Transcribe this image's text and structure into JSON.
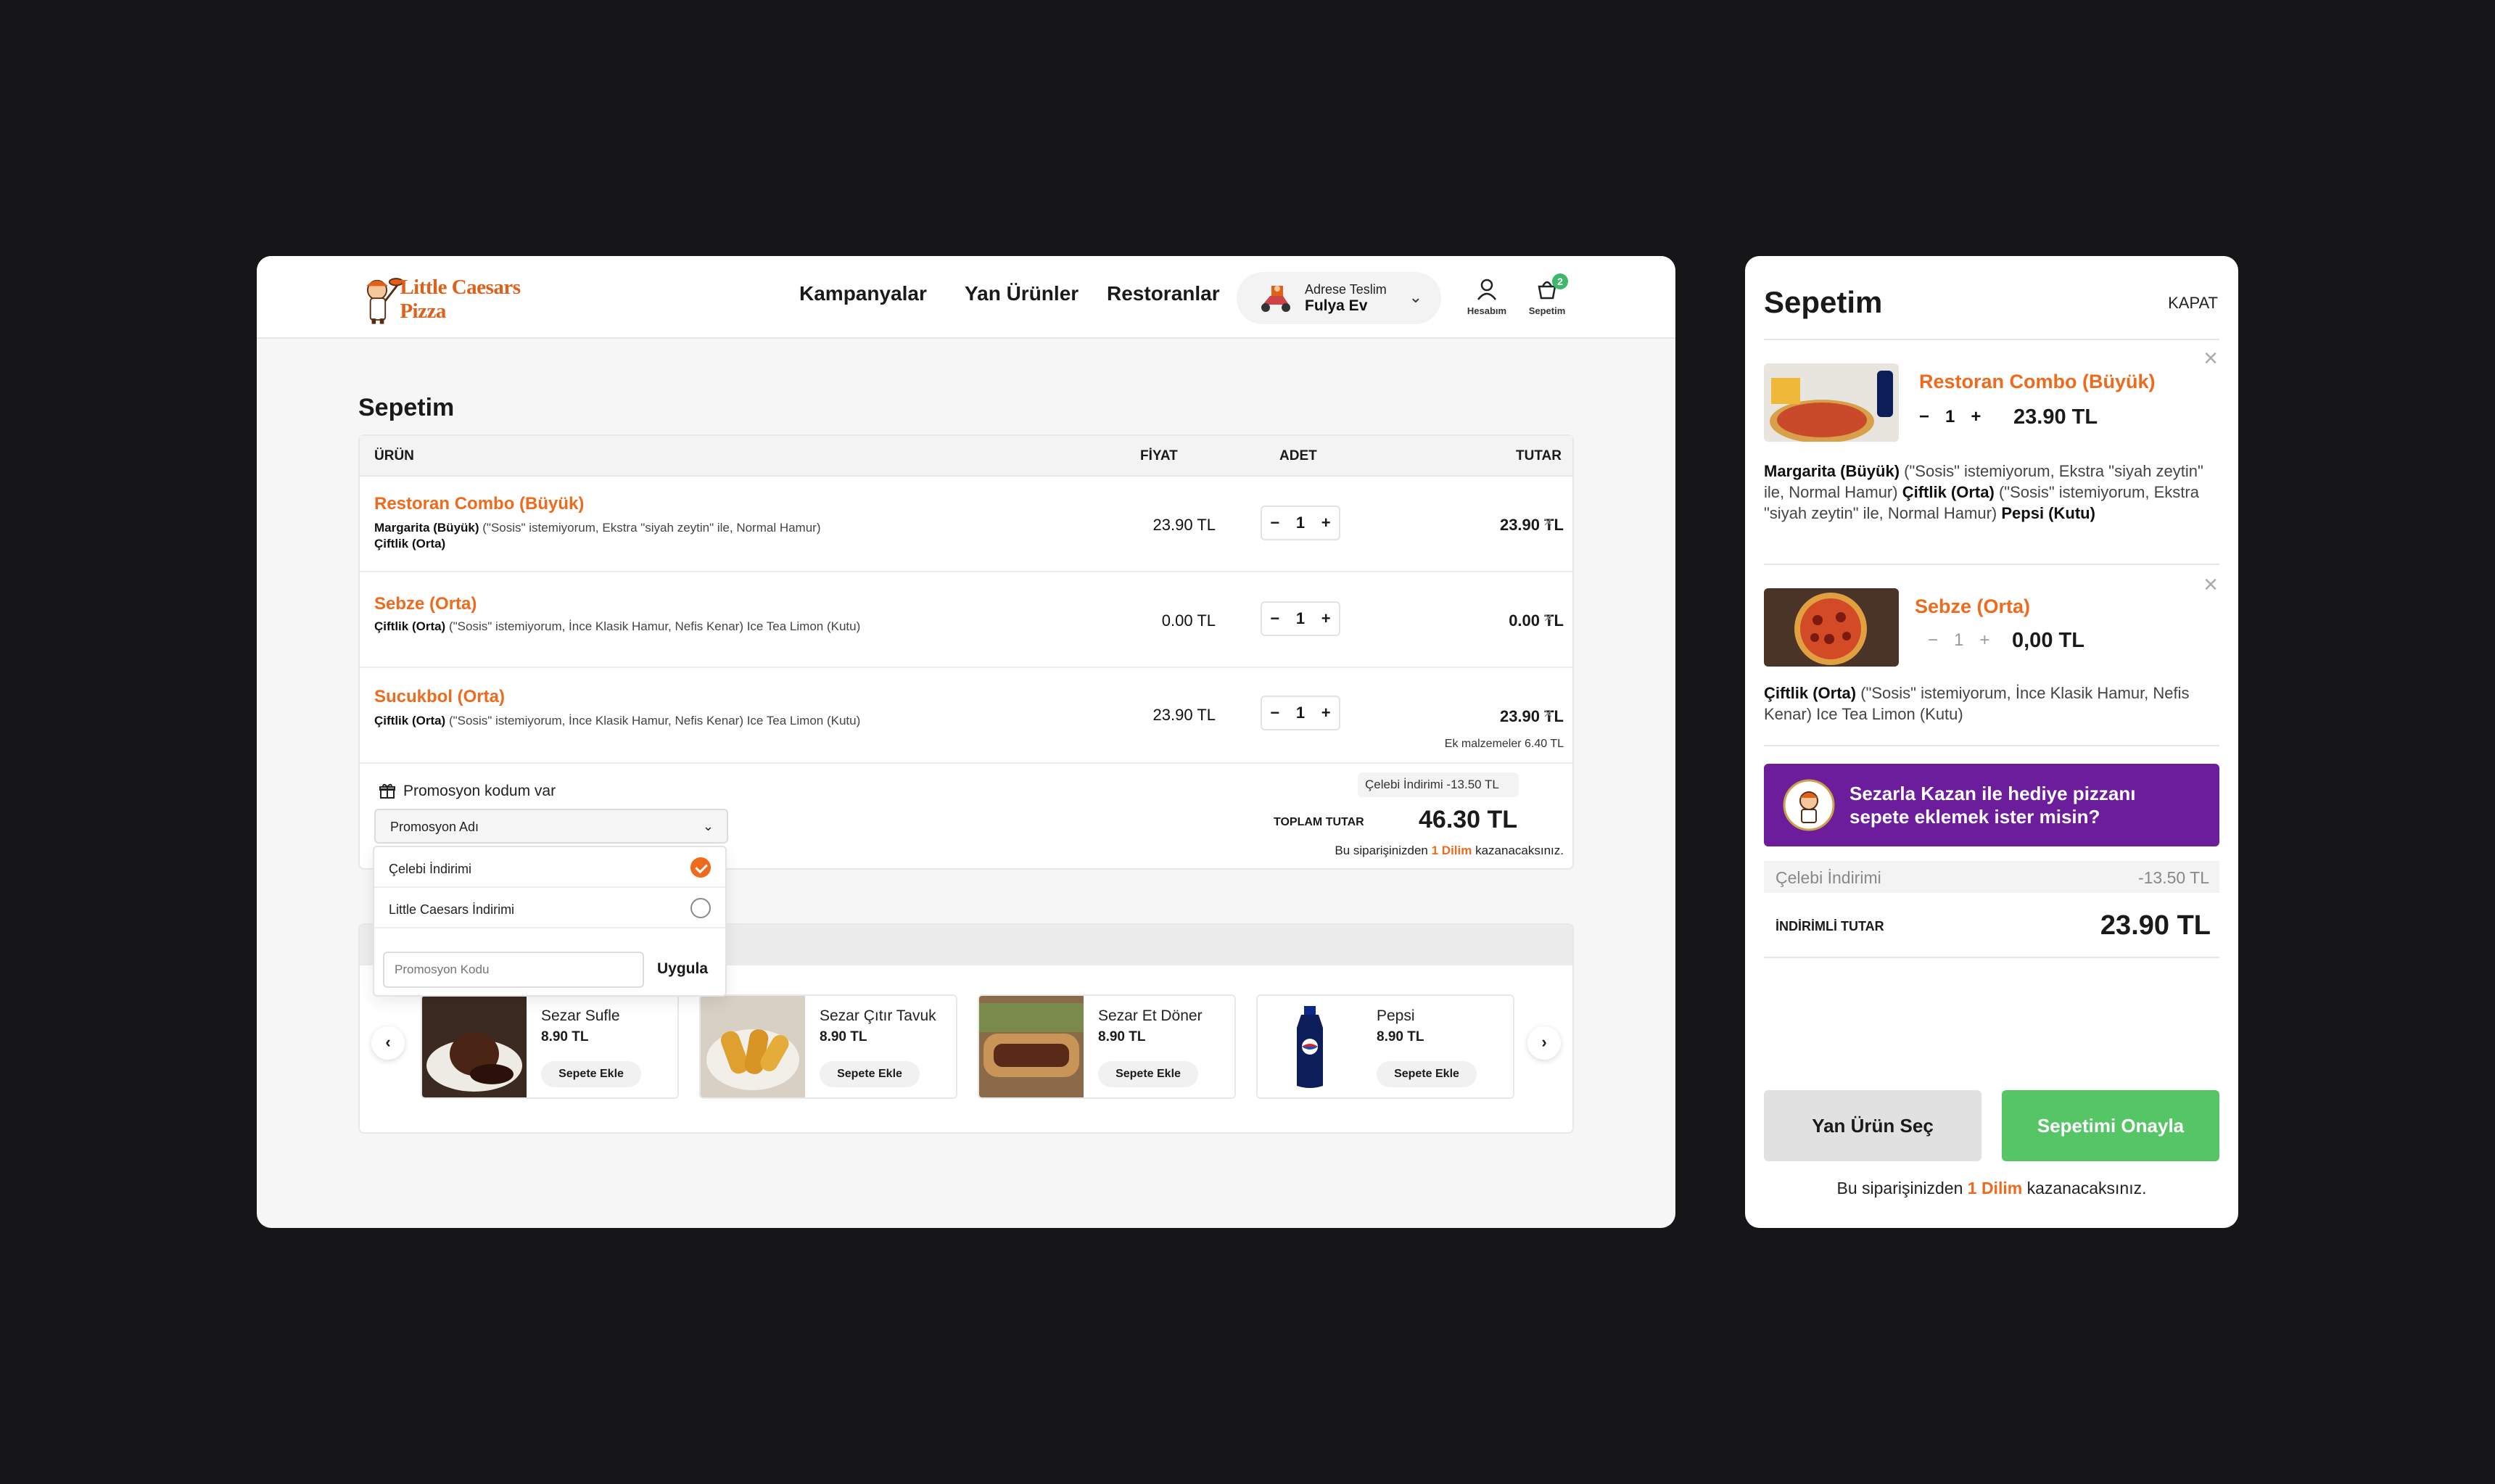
{
  "header": {
    "brand": "Little Caesars Pizza",
    "nav": [
      "Kampanyalar",
      "Yan Ürünler",
      "Restoranlar"
    ],
    "address": {
      "label": "Adrese Teslim",
      "value": "Fulya Ev"
    },
    "account_label": "Hesabım",
    "cart_label": "Sepetim",
    "cart_count": "2"
  },
  "page": {
    "title": "Sepetim",
    "columns": {
      "product": "ÜRÜN",
      "price": "FİYAT",
      "qty": "ADET",
      "total": "TUTAR"
    },
    "items": [
      {
        "name": "Restoran Combo (Büyük)",
        "desc_bold1": "Margarita (Büyük)",
        "desc1": " (\"Sosis\" istemiyorum, Ekstra \"siyah zeytin\" ile, Normal Hamur) ",
        "desc_bold2": "Çiftlik (Orta)",
        "price": "23.90 TL",
        "qty": "1",
        "total": "23.90 TL",
        "extra": ""
      },
      {
        "name": "Sebze (Orta)",
        "desc_bold1": "Çiftlik (Orta)",
        "desc1": " (\"Sosis\" istemiyorum, İnce Klasik Hamur, Nefis Kenar) Ice Tea Limon (Kutu)",
        "desc_bold2": "",
        "price": "0.00 TL",
        "qty": "1",
        "total": "0.00 TL",
        "extra": ""
      },
      {
        "name": "Sucukbol (Orta)",
        "desc_bold1": "Çiftlik (Orta)",
        "desc1": " (\"Sosis\" istemiyorum, İnce Klasik Hamur, Nefis Kenar) Ice Tea Limon (Kutu)",
        "desc_bold2": "",
        "price": "23.90 TL",
        "qty": "1",
        "total": "23.90 TL",
        "extra": "Ek malzemeler 6.40 TL"
      }
    ],
    "promo": {
      "toggle_label": "Promosyon kodum var",
      "select_value": "Promosyon Adı",
      "options": [
        {
          "label": "Çelebi İndirimi",
          "selected": true
        },
        {
          "label": "Little Caesars İndirimi",
          "selected": false
        }
      ],
      "code_placeholder": "Promosyon Kodu",
      "apply_label": "Uygula"
    },
    "summary": {
      "discount": "Çelebi İndirimi  -13.50 TL",
      "total_label": "TOPLAM TUTAR",
      "total_value": "46.30 TL",
      "earn_prefix": "Bu siparişinizden ",
      "earn_highlight": "1 Dilim",
      "earn_suffix": " kazanacaksınız."
    },
    "side_products": [
      {
        "name": "Sezar Sufle",
        "price": "8.90 TL",
        "button": "Sepete Ekle"
      },
      {
        "name": "Sezar Çıtır Tavuk",
        "price": "8.90 TL",
        "button": "Sepete Ekle"
      },
      {
        "name": "Sezar Et Döner",
        "price": "8.90 TL",
        "button": "Sepete Ekle"
      },
      {
        "name": "Pepsi",
        "price": "8.90 TL",
        "button": "Sepete Ekle"
      }
    ]
  },
  "side_cart": {
    "title": "Sepetim",
    "close_label": "KAPAT",
    "items": [
      {
        "name": "Restoran Combo (Büyük)",
        "qty": "1",
        "total": "23.90 TL",
        "bold1": "Margarita (Büyük)",
        "text1": " (\"Sosis\" istemiyorum, Ekstra \"siyah zeytin\" ile, Normal Hamur) ",
        "bold2": "Çiftlik (Orta)",
        "text2": " (\"Sosis\" istemiyorum, Ekstra \"siyah zeytin\" ile, Normal Hamur) ",
        "bold3": "Pepsi (Kutu)"
      },
      {
        "name": "Sebze (Orta)",
        "qty": "1",
        "total": "0,00 TL",
        "bold1": "Çiftlik (Orta)",
        "text1": " (\"Sosis\" istemiyorum, İnce Klasik Hamur, Nefis Kenar) Ice Tea Limon (Kutu)"
      }
    ],
    "banner_text": "Sezarla Kazan ile hediye pizzanı sepete eklemek ister misin?",
    "discount_label": "Çelebi İndirimi",
    "discount_value": "-13.50 TL",
    "total_label": "İNDİRİMLİ TUTAR",
    "total_value": "23.90 TL",
    "btn_secondary": "Yan Ürün Seç",
    "btn_primary": "Sepetimi Onayla",
    "earn_prefix": "Bu siparişinizden ",
    "earn_highlight": "1 Dilim",
    "earn_suffix": " kazanacaksınız."
  },
  "colors": {
    "accent": "#ee6a1c",
    "confirm": "#55c566",
    "banner": "#6b1d9c",
    "badge": "#3bb86a"
  }
}
